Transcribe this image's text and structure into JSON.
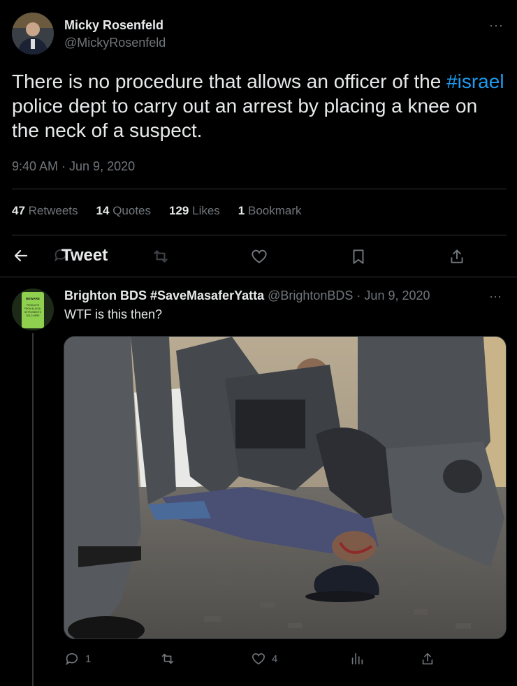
{
  "tweet": {
    "author_name": "Micky Rosenfeld",
    "author_handle": "@MickyRosenfeld",
    "text_before": "There is no procedure that allows an officer of the ",
    "hashtag": "#israel",
    "text_after": " police dept to carry out an arrest by placing a knee on the neck of a suspect.",
    "timestamp": "9:40 AM · Jun 9, 2020",
    "more_label": "···"
  },
  "stats": [
    {
      "count": "47",
      "label": "Retweets"
    },
    {
      "count": "14",
      "label": "Quotes"
    },
    {
      "count": "129",
      "label": "Likes"
    },
    {
      "count": "1",
      "label": "Bookmark"
    }
  ],
  "action_bar": {
    "title": "Tweet"
  },
  "reply": {
    "author_name": "Brighton BDS #SaveMasaferYatta",
    "meta": "@BrightonBDS · Jun 9, 2020",
    "text": "WTF is this then?",
    "more_label": "···",
    "avatar_sign_lines": [
      "BEWARE",
      "PRODUCTS",
      "FROM ILLEGAL",
      "SETTLEMENTS",
      "SOLD HERE"
    ],
    "reply_count": "1",
    "like_count": "4"
  },
  "colors": {
    "background": "#000000",
    "text_primary": "#e7e9ea",
    "text_secondary": "#71767b",
    "accent": "#1d9bf0",
    "divider": "#2f3336"
  }
}
